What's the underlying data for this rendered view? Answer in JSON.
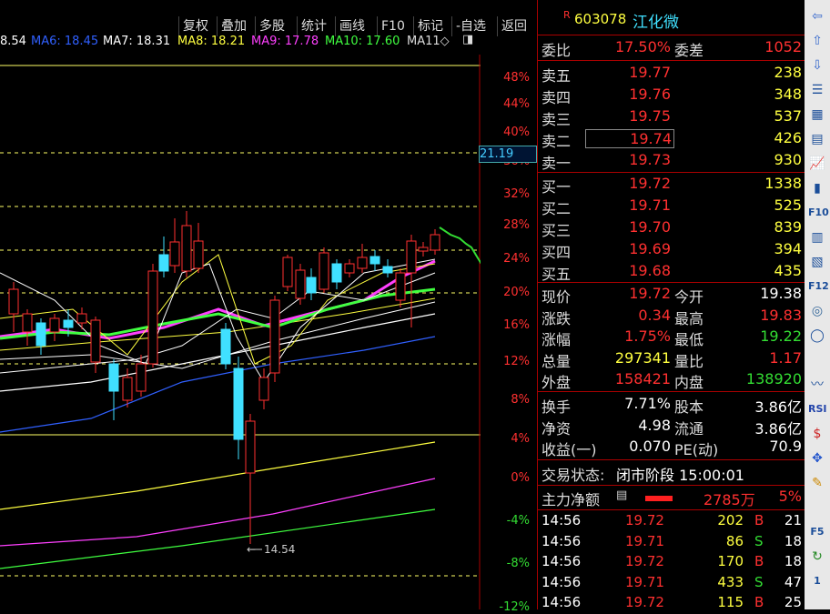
{
  "toolbar": {
    "buttons": [
      "复权",
      "叠加",
      "多股",
      "统计",
      "画线",
      "F10",
      "标记",
      "-自选",
      "返回"
    ]
  },
  "ma_legend": [
    {
      "label": "8.54",
      "color": "#ffffff"
    },
    {
      "label": "MA6: 18.45",
      "color": "#3060ff"
    },
    {
      "label": "MA7: 18.31",
      "color": "#ffffff"
    },
    {
      "label": "MA8: 18.21",
      "color": "#ffff40"
    },
    {
      "label": "MA9: 17.78",
      "color": "#ff40ff"
    },
    {
      "label": "MA10: 17.60",
      "color": "#40ff40"
    },
    {
      "label": "MA11◇",
      "color": "#dddddd"
    }
  ],
  "axis": {
    "pct_labels": [
      "48%",
      "44%",
      "40%",
      "36%",
      "32%",
      "28%",
      "24%",
      "20%",
      "16%",
      "12%",
      "8%",
      "4%",
      "0%",
      "-4%",
      "-8%",
      "-12%"
    ],
    "price_tag": "21.19",
    "low_marker": "14.54"
  },
  "chart_data": {
    "type": "candlestick",
    "y_unit": "price change %",
    "low_label": "14.54"
  },
  "stock": {
    "flag": "R",
    "code": "603078",
    "name": "江化微"
  },
  "weibi": {
    "label": "委比",
    "value": "17.50%",
    "label2": "委差",
    "value2": "1052"
  },
  "sell": [
    {
      "label": "卖五",
      "price": "19.77",
      "vol": "238"
    },
    {
      "label": "卖四",
      "price": "19.76",
      "vol": "348"
    },
    {
      "label": "卖三",
      "price": "19.75",
      "vol": "537"
    },
    {
      "label": "卖二",
      "price": "19.74",
      "vol": "426"
    },
    {
      "label": "卖一",
      "price": "19.73",
      "vol": "930"
    }
  ],
  "buy": [
    {
      "label": "买一",
      "price": "19.72",
      "vol": "1338"
    },
    {
      "label": "买二",
      "price": "19.71",
      "vol": "525"
    },
    {
      "label": "买三",
      "price": "19.70",
      "vol": "839"
    },
    {
      "label": "买四",
      "price": "19.69",
      "vol": "394"
    },
    {
      "label": "买五",
      "price": "19.68",
      "vol": "435"
    }
  ],
  "quote": [
    {
      "l1": "现价",
      "v1": "19.72",
      "c1": "red",
      "l2": "今开",
      "v2": "19.38",
      "c2": "wht"
    },
    {
      "l1": "涨跌",
      "v1": "0.34",
      "c1": "red",
      "l2": "最高",
      "v2": "19.83",
      "c2": "red"
    },
    {
      "l1": "涨幅",
      "v1": "1.75%",
      "c1": "red",
      "l2": "最低",
      "v2": "19.22",
      "c2": "grn"
    },
    {
      "l1": "总量",
      "v1": "297341",
      "c1": "yel",
      "l2": "量比",
      "v2": "1.17",
      "c2": "red"
    },
    {
      "l1": "外盘",
      "v1": "158421",
      "c1": "red",
      "l2": "内盘",
      "v2": "138920",
      "c2": "grn"
    }
  ],
  "stats": [
    {
      "l1": "换手",
      "v1": "7.71%",
      "l2": "股本",
      "v2": "3.86亿"
    },
    {
      "l1": "净资",
      "v1": "4.98",
      "l2": "流通",
      "v2": "3.86亿"
    },
    {
      "l1": "收益(一)",
      "v1": "0.070",
      "l2": "PE(动)",
      "v2": "70.9"
    }
  ],
  "status": {
    "label": "交易状态:",
    "value": "闭市阶段 15:00:01"
  },
  "mainforce": {
    "label": "主力净额",
    "value": "2785万",
    "pct": "5%"
  },
  "ticks": [
    {
      "time": "14:56",
      "price": "19.72",
      "vol": "202",
      "side": "B",
      "n": "21"
    },
    {
      "time": "14:56",
      "price": "19.71",
      "vol": "86",
      "side": "S",
      "n": "18"
    },
    {
      "time": "14:56",
      "price": "19.72",
      "vol": "170",
      "side": "B",
      "n": "18"
    },
    {
      "time": "14:56",
      "price": "19.71",
      "vol": "433",
      "side": "S",
      "n": "47"
    },
    {
      "time": "14:56",
      "price": "19.72",
      "vol": "115",
      "side": "B",
      "n": "25"
    }
  ],
  "side_icons": [
    "arrow-left-icon",
    "arrow-up-icon",
    "arrow-down-icon",
    "list-icon",
    "table-icon",
    "report-icon",
    "line-chart-icon",
    "kline-icon",
    "f10-icon",
    "fund-icon",
    "note-icon",
    "f12-icon",
    "ring-icon",
    "circle-icon",
    "",
    "wave-icon",
    "rsi-icon",
    "dollar-icon",
    "move-icon",
    "pencil-icon",
    "",
    "f5-icon",
    "refresh-icon",
    "one-icon"
  ],
  "side_labels": {
    "f10": "F10",
    "f12": "F12",
    "rsi": "RSI",
    "f5": "F5",
    "one": "1"
  }
}
